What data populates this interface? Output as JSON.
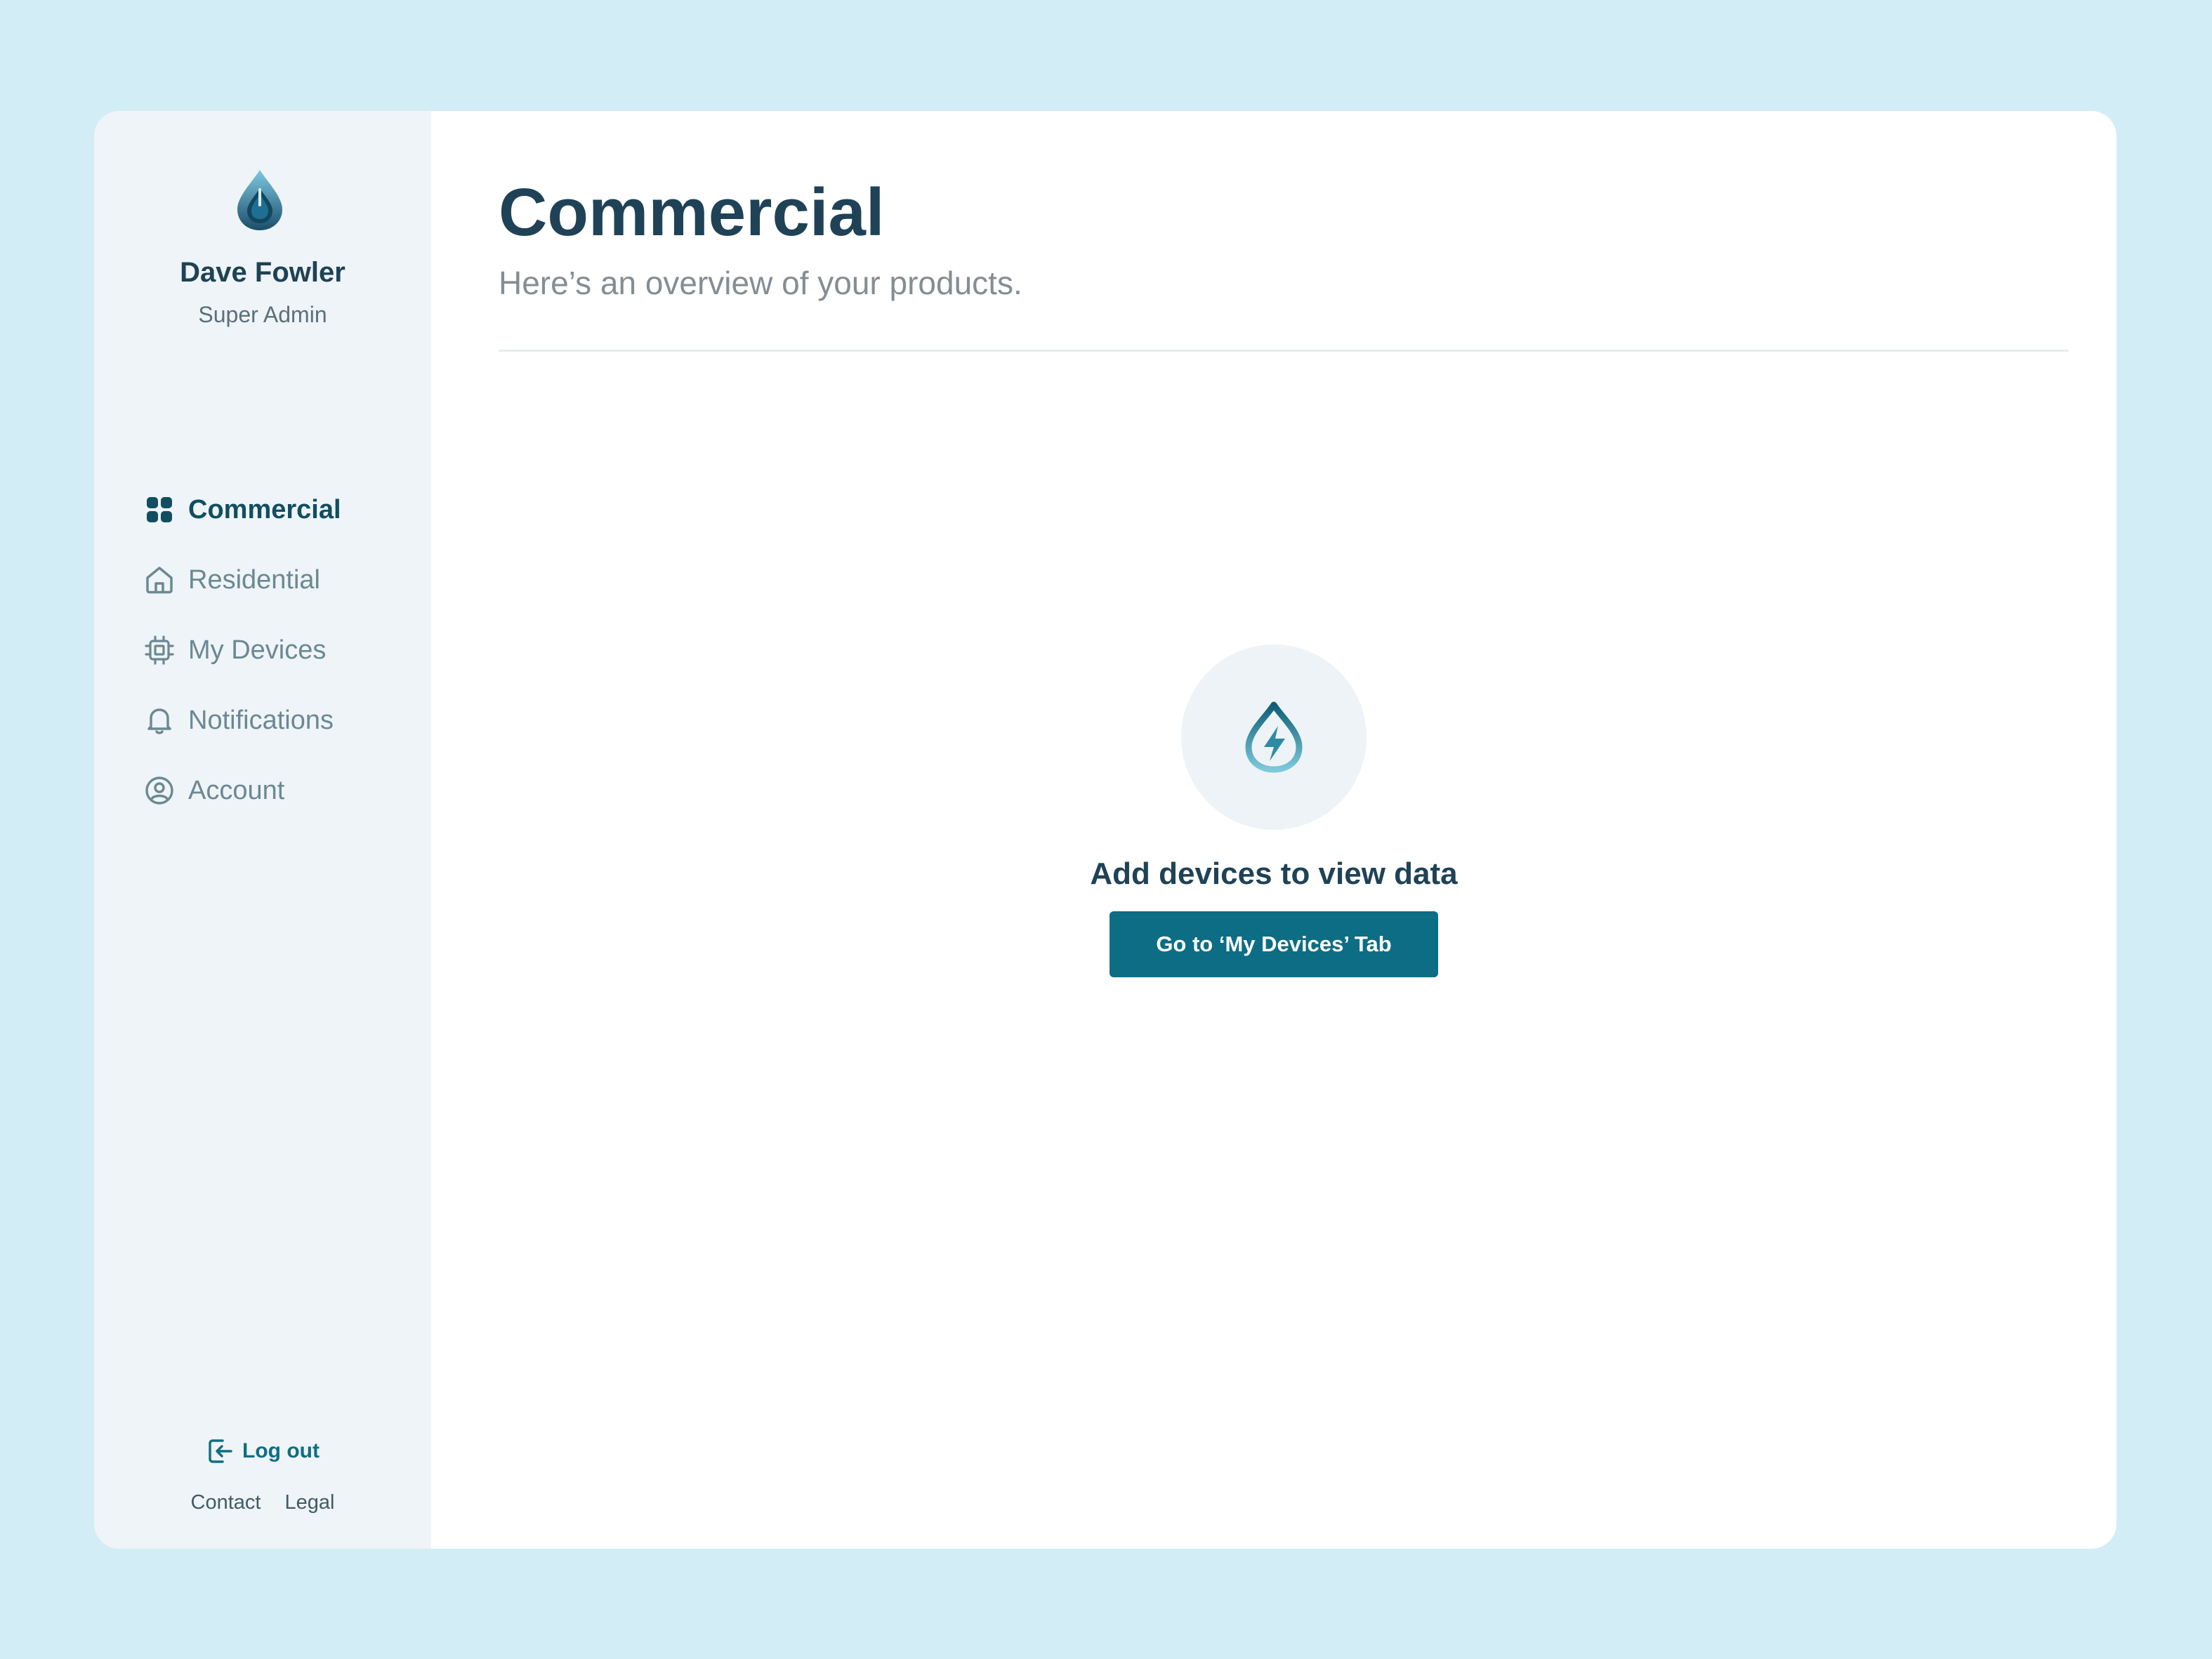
{
  "user": {
    "name": "Dave Fowler",
    "role": "Super Admin"
  },
  "nav": {
    "items": [
      {
        "label": "Commercial",
        "icon": "grid-icon",
        "active": true
      },
      {
        "label": "Residential",
        "icon": "home-icon",
        "active": false
      },
      {
        "label": "My Devices",
        "icon": "chip-icon",
        "active": false
      },
      {
        "label": "Notifications",
        "icon": "bell-icon",
        "active": false
      },
      {
        "label": "Account",
        "icon": "user-circle-icon",
        "active": false
      }
    ]
  },
  "footer": {
    "logout_label": "Log out",
    "contact_label": "Contact",
    "legal_label": "Legal"
  },
  "main": {
    "title": "Commercial",
    "subtitle": "Here’s an overview of your products.",
    "empty_state": {
      "message": "Add devices to view data",
      "button_label": "Go to ‘My Devices’ Tab"
    }
  },
  "colors": {
    "background": "#d2edf5",
    "sidebar": "#eef4f7",
    "primary": "#0d6d84",
    "heading": "#1f4256",
    "nav_inactive": "#6c8893"
  }
}
